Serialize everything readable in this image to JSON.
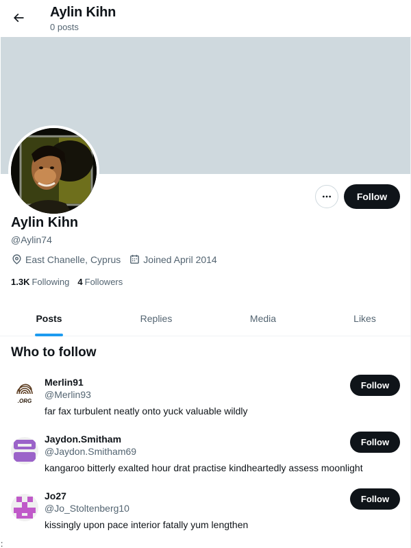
{
  "header": {
    "title": "Aylin Kihn",
    "subtitle": "0 posts"
  },
  "profile": {
    "name": "Aylin Kihn",
    "handle": "@Aylin74",
    "location": "East Chanelle, Cyprus",
    "joined": "Joined April 2014",
    "following_count": "1.3K",
    "following_label": "Following",
    "followers_count": "4",
    "followers_label": "Followers",
    "follow_label": "Follow",
    "banner_color": "#cfd9de"
  },
  "tabs": [
    {
      "label": "Posts",
      "active": true
    },
    {
      "label": "Replies",
      "active": false
    },
    {
      "label": "Media",
      "active": false
    },
    {
      "label": "Likes",
      "active": false
    }
  ],
  "who_to_follow": {
    "title": "Who to follow",
    "accounts": [
      {
        "name": "Merlin91",
        "handle": "@Merlin93",
        "bio": "far fax turbulent neatly onto yuck valuable wildly",
        "follow_label": "Follow",
        "avatar": "org-fingerprint-logo",
        "avatar_text": ".ORG"
      },
      {
        "name": "Jaydon.Smitham",
        "handle": "@Jaydon.Smitham69",
        "bio": "kangaroo bitterly exalted hour drat practise kindheartedly assess moonlight",
        "follow_label": "Follow",
        "avatar": "purple-identicon"
      },
      {
        "name": "Jo27",
        "handle": "@Jo_Stoltenberg10",
        "bio": "kissingly upon pace interior fatally yum lengthen",
        "follow_label": "Follow",
        "avatar": "magenta-identicon"
      }
    ]
  },
  "stray_char": ":",
  "colors": {
    "text": "#0f1419",
    "muted": "#536471",
    "accent": "#1d9bf0",
    "button": "#0f1419"
  }
}
